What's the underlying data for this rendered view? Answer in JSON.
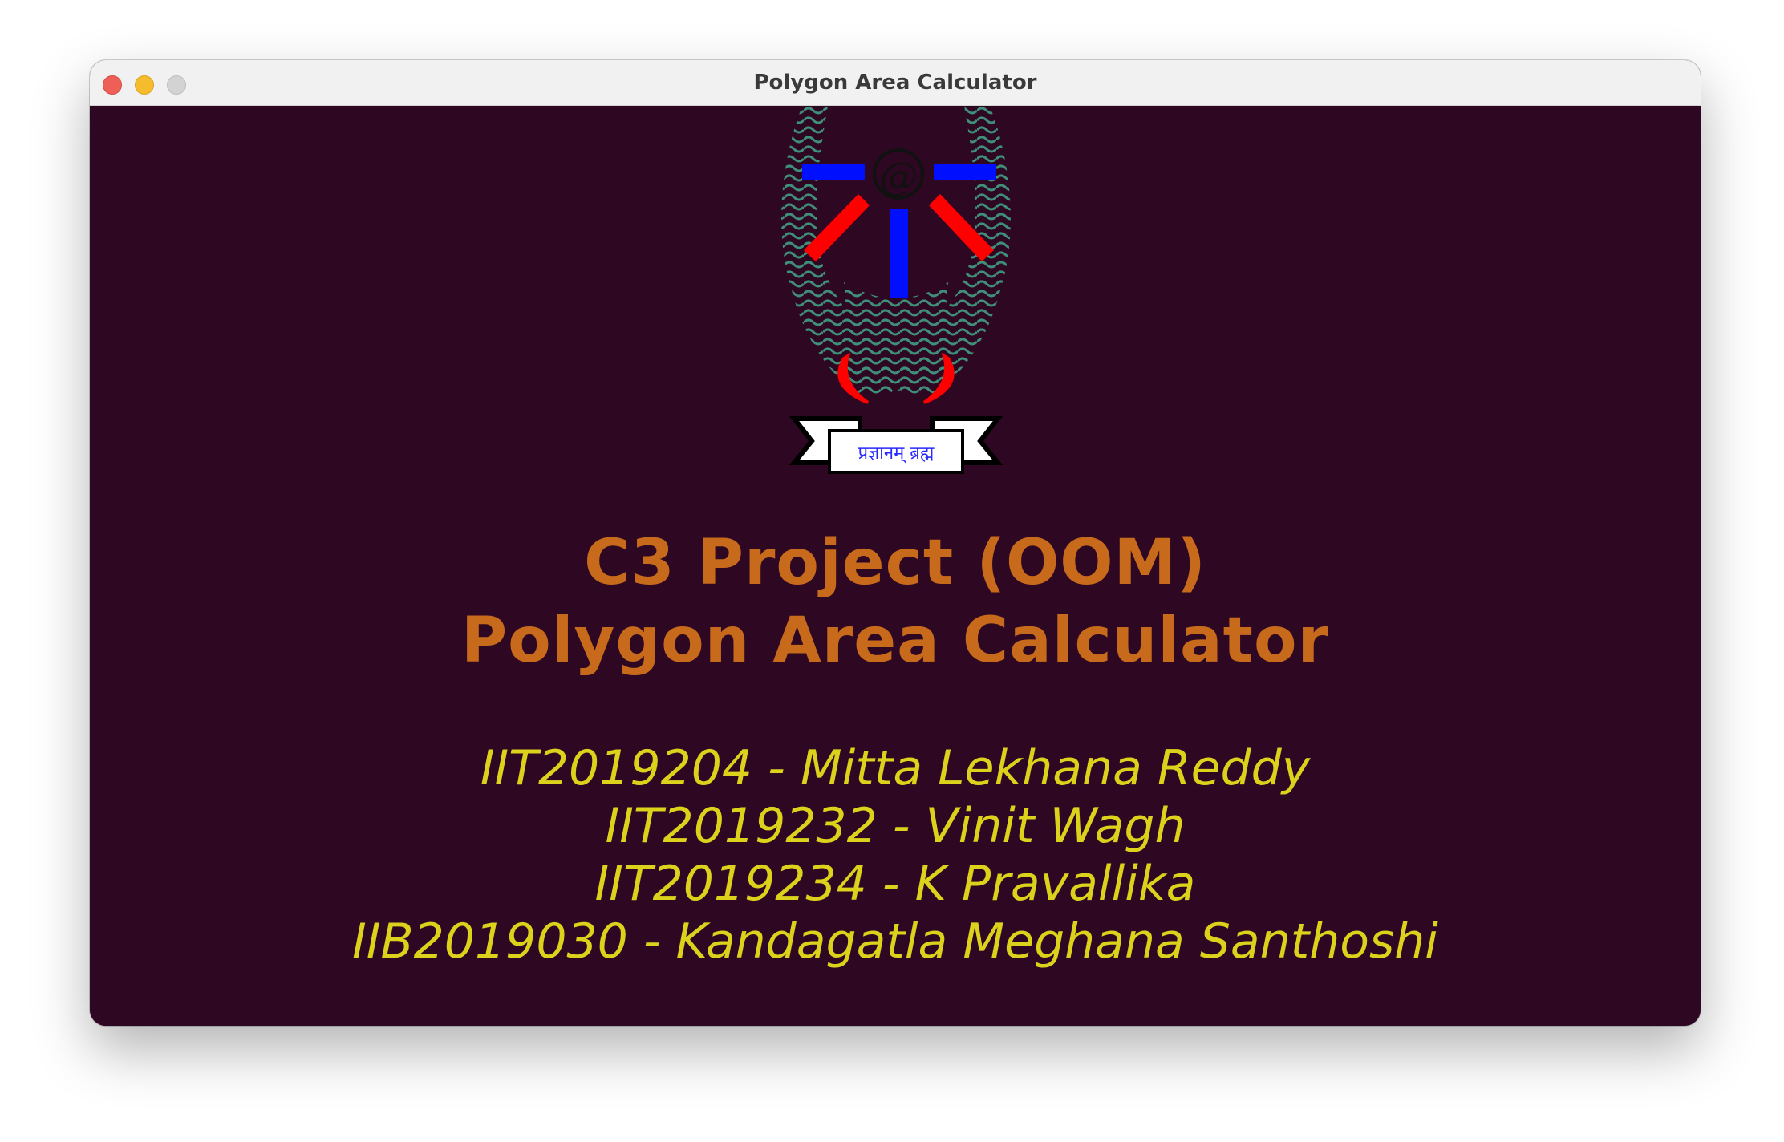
{
  "window": {
    "title": "Polygon Area Calculator"
  },
  "logo": {
    "symbol": "@",
    "motto": "प्रज्ञानम् ब्रह्म",
    "colors": {
      "horns": "#3f8f7b",
      "arms": "#0010ff",
      "rays": "#ff0000",
      "ribbon": "#ffffff"
    }
  },
  "header": {
    "line1": "C3 Project (OOM)",
    "line2": "Polygon Area Calculator"
  },
  "members": [
    "IIT2019204 - Mitta Lekhana Reddy",
    "IIT2019232 - Vinit Wagh",
    "IIT2019234 - K Pravallika",
    "IIB2019030 - Kandagatla Meghana Santhoshi"
  ],
  "colors": {
    "background": "#2e0722",
    "heading": "#c86a1c",
    "members": "#dcd21c"
  }
}
